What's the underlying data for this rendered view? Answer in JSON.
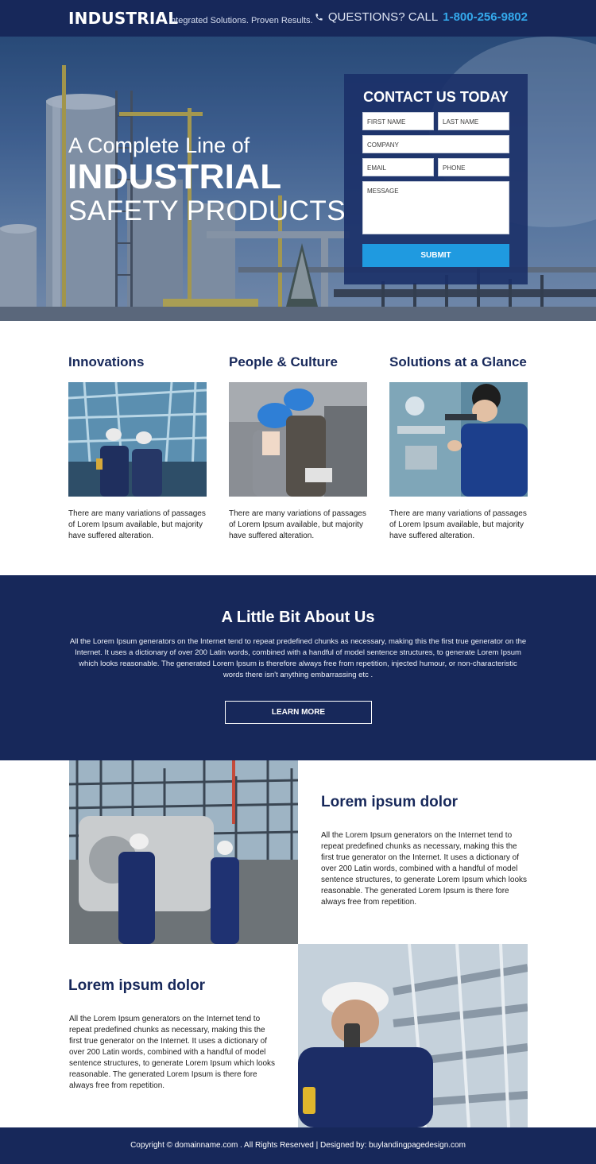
{
  "header": {
    "brand": "INDUSTRIAL",
    "tagline": "Integrated Solutions. Proven Results.",
    "phone_label": "QUESTIONS? CALL",
    "phone_number": "1-800-256-9802",
    "phone_icon": "phone-icon"
  },
  "hero": {
    "line1": "A Complete Line of",
    "line2": "INDUSTRIAL",
    "line3": "SAFETY PRODUCTS"
  },
  "form": {
    "title": "CONTACT US TODAY",
    "first_name": "FIRST NAME",
    "last_name": "LAST NAME",
    "company": "COMPANY",
    "email": "EMAIL",
    "phone": "PHONE",
    "message": "MESSAGE",
    "submit": "SUBMIT"
  },
  "features": [
    {
      "title": "Innovations",
      "text": "There are many variations of passages of Lorem Ipsum available, but majority have suffered alteration."
    },
    {
      "title": "People & Culture",
      "text": "There are many variations of passages of Lorem Ipsum available, but majority have suffered alteration."
    },
    {
      "title": "Solutions at a Glance",
      "text": "There are many variations of passages of Lorem Ipsum available, but majority have suffered alteration."
    }
  ],
  "about": {
    "title": "A Little Bit About Us",
    "text": "All the Lorem Ipsum generators on the Internet tend to repeat predefined chunks as necessary, making this the first true generator on the Internet. It uses a dictionary of over 200 Latin words, combined with a handful of model sentence structures, to generate Lorem Ipsum which looks reasonable. The generated Lorem Ipsum is therefore always free from repetition, injected humour, or non-characteristic words there isn't anything embarrassing etc .",
    "button": "LEARN MORE"
  },
  "sections": [
    {
      "title": "Lorem ipsum dolor",
      "text": "All the Lorem Ipsum generators on the Internet tend to repeat predefined chunks as necessary, making this the first true generator on the Internet. It uses a dictionary of over 200 Latin words, combined with a handful of model sentence structures, to generate Lorem Ipsum which looks reasonable. The generated Lorem Ipsum is there fore always free from repetition."
    },
    {
      "title": "Lorem ipsum dolor",
      "text": "All the Lorem Ipsum generators on the Internet tend to repeat predefined chunks as necessary, making this the first true generator on the Internet. It uses a dictionary of over 200 Latin words, combined with a handful of model sentence structures, to generate Lorem Ipsum which looks reasonable. The generated Lorem Ipsum is there fore always free from repetition."
    }
  ],
  "footer": {
    "text": "Copyright © domainname.com . All Rights Reserved | Designed by: buylandingpagedesign.com"
  },
  "colors": {
    "navy": "#17285a",
    "accent_blue": "#34a9ec",
    "button_blue": "#1f9ae0"
  }
}
